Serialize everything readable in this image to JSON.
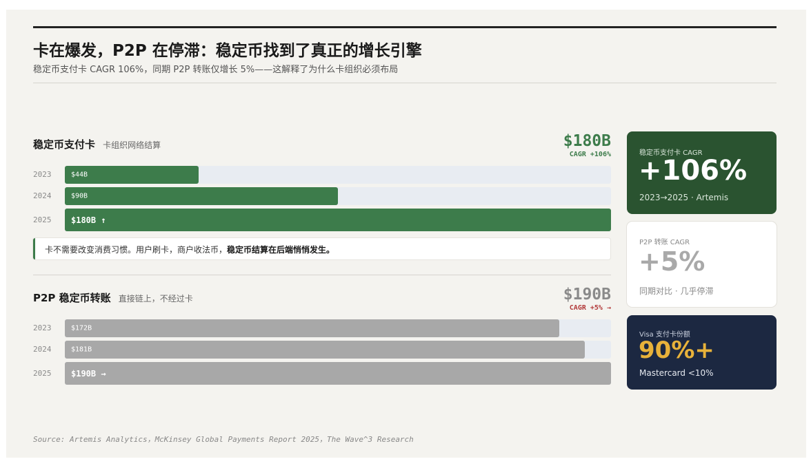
{
  "header": {
    "title": "卡在爆发，P2P 在停滞：稳定币找到了真正的增长引擎",
    "subtitle": "稳定币支付卡 CAGR 106%，同期 P2P 转账仅增长 5%——这解释了为什么卡组织必须布局"
  },
  "chart_data": [
    {
      "type": "bar",
      "orientation": "horizontal",
      "title": "稳定币支付卡",
      "subtitle": "卡组织网络结算",
      "headline_value": "$180B",
      "headline_tag": "CAGR +106%",
      "categories": [
        "2023",
        "2024",
        "2025"
      ],
      "values": [
        44,
        90,
        180
      ],
      "bar_labels": [
        "$44B",
        "$90B",
        "$180B ↑"
      ],
      "unit": "$B",
      "xlim": [
        0,
        180
      ],
      "color": "#3d7c4b"
    },
    {
      "type": "bar",
      "orientation": "horizontal",
      "title": "P2P 稳定币转账",
      "subtitle": "直接链上，不经过卡",
      "headline_value": "$190B",
      "headline_tag": "CAGR +5% →",
      "categories": [
        "2023",
        "2024",
        "2025"
      ],
      "values": [
        172,
        181,
        190
      ],
      "bar_labels": [
        "$172B",
        "$181B",
        "$190B →"
      ],
      "unit": "$B",
      "xlim": [
        0,
        190
      ],
      "color": "#a8a8a8"
    }
  ],
  "callout": {
    "text": "卡不需要改变消费习惯。用户刷卡，商户收法币，",
    "emphasis": "稳定币结算在后端悄悄发生。"
  },
  "cards": [
    {
      "label": "稳定币支付卡 CAGR",
      "value": "+106%",
      "foot": "2023→2025 · Artemis",
      "bg": "#2a5330",
      "value_color": "#ffffff"
    },
    {
      "label": "P2P 转账 CAGR",
      "value": "+5%",
      "foot": "同期对比 · 几乎停滞",
      "bg": "#ffffff",
      "value_color": "#a9a9a9"
    },
    {
      "label": "Visa 支付卡份额",
      "value": "90%+",
      "foot": "Mastercard <10%",
      "bg": "#1c2841",
      "value_color": "#e8b23a"
    }
  ],
  "colors": {
    "card_accent": "#3d7c4b",
    "card_tag": "#3d7c4b",
    "p2p_tag": "#b23a3a",
    "p2p_value": "#8a8a8a",
    "track": "#e8ecf2"
  },
  "footer": {
    "source": "Source: Artemis Analytics，McKinsey Global Payments Report 2025，The Wave^3 Research"
  }
}
